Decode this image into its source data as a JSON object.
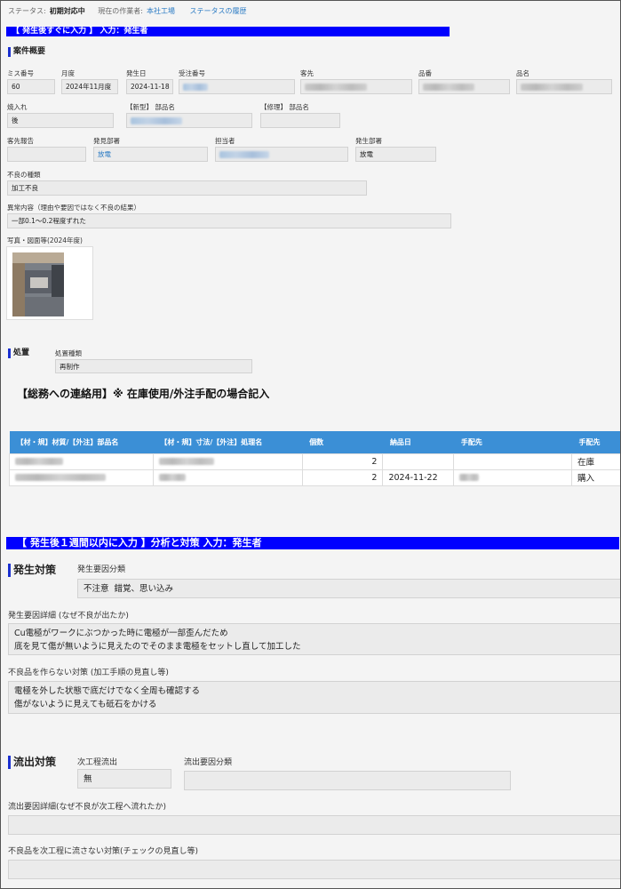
{
  "header": {
    "status_label": "ステータス:",
    "status_value": "初期対応中",
    "worker_label": "現在の作業者:",
    "worker_value": "本社工場",
    "history_link": "ステータスの履歴"
  },
  "banner1": "【 発生後すぐに入力 】     入力：発生者",
  "overview": {
    "title": "案件概要",
    "fields": {
      "miss_no": {
        "label": "ミス番号",
        "value": "60"
      },
      "month": {
        "label": "月度",
        "value": "2024年11月度"
      },
      "date": {
        "label": "発生日",
        "value": "2024-11-18"
      },
      "order_no": {
        "label": "受注番号"
      },
      "customer": {
        "label": "客先"
      },
      "part_no": {
        "label": "品番"
      },
      "part_name": {
        "label": "品名"
      },
      "yakiire": {
        "label": "焼入れ",
        "value": "後"
      },
      "new_part": {
        "label": "【新型】 部品名"
      },
      "repair_part": {
        "label": "【修理】 部品名"
      },
      "customer_report": {
        "label": "客先報告"
      },
      "found_dept": {
        "label": "発見部署",
        "value": "放電"
      },
      "person": {
        "label": "担当者"
      },
      "origin_dept": {
        "label": "発生部署",
        "value": "放電"
      },
      "defect_type": {
        "label": "不良の種類",
        "value": "加工不良"
      },
      "abnormal": {
        "label": "異常内容（理由や要因ではなく不良の結果）",
        "value": "一部0.1～0.2程度ずれた"
      },
      "photo": {
        "label": "写真・図面等(2024年度)"
      }
    }
  },
  "disposal": {
    "title": "処置",
    "type_label": "処置種類",
    "type_value": "再制作"
  },
  "contact_headline": "【総務への連絡用】※ 在庫使用/外注手配の場合記入",
  "materials_table": {
    "headers": [
      "【材・規】材質/【外注】部品名",
      "【材・規】寸法/【外注】処理名",
      "個数",
      "納品日",
      "手配先",
      "手配先"
    ],
    "rows": [
      {
        "qty": "2",
        "date": "",
        "dest": "在庫"
      },
      {
        "qty": "2",
        "date": "2024-11-22",
        "dest": "購入"
      }
    ]
  },
  "banner2": "【 発生後１週間以内に入力 】分析と対策      入力：発生者",
  "occurrence": {
    "title": "発生対策",
    "cause_class_label": "発生要因分類",
    "cause_class_value": "不注意  錯覚、思い込み",
    "cause_detail_label": "発生要因詳細 (なぜ不良が出たか)",
    "cause_detail_value": "Cu電極がワークにぶつかった時に電極が一部歪んだため\n底を見て傷が無いように見えたのでそのまま電極をセットし直して加工した",
    "prevent_label": "不良品を作らない対策 (加工手順の見直し等)",
    "prevent_value": "電極を外した状態で底だけでなく全周も確認する\n傷がないように見えても砥石をかける"
  },
  "outflow": {
    "title": "流出対策",
    "next_process_label": "次工程流出",
    "next_process_value": "無",
    "outflow_class_label": "流出要因分類",
    "outflow_class_value": "",
    "outflow_detail_label": "流出要因詳細(なぜ不良が次工程へ流れたか)",
    "outflow_detail_value": "",
    "outflow_prevent_label": "不良品を次工程に流さない対策(チェックの見直し等)",
    "outflow_prevent_value": ""
  }
}
